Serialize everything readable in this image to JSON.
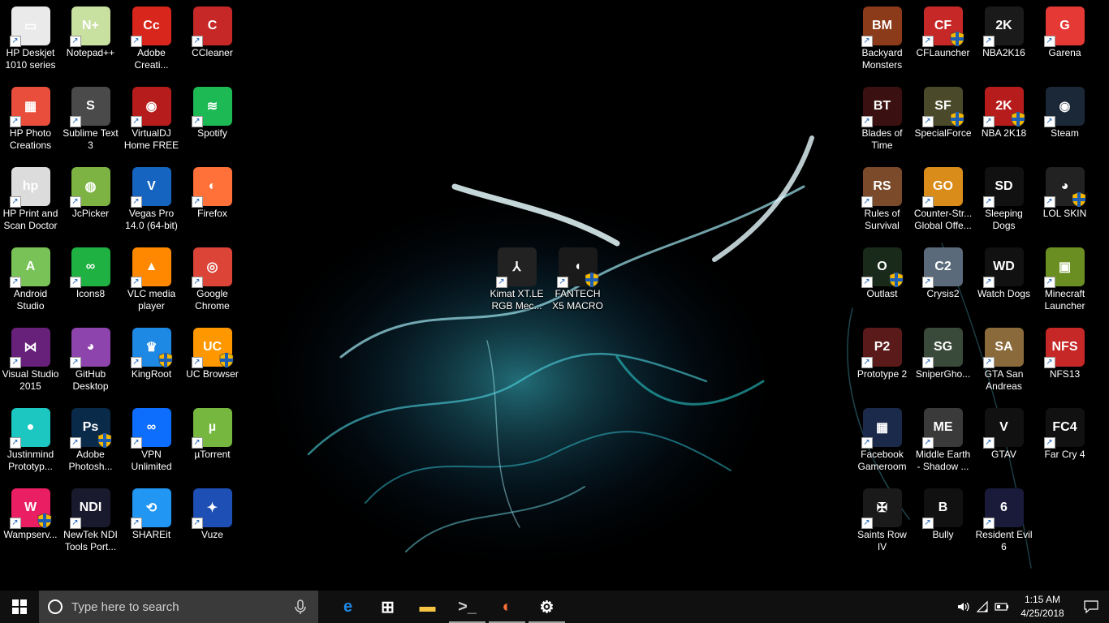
{
  "desktop": {
    "left_icons": [
      {
        "label": "HP Deskjet 1010 series",
        "icon": "printer-icon",
        "color": "#eaeaea",
        "glyph": "▭",
        "shield": false
      },
      {
        "label": "Notepad++",
        "icon": "notepad-plus-plus-icon",
        "color": "#c8e0a0",
        "glyph": "N+",
        "shield": false
      },
      {
        "label": "Adobe Creati...",
        "icon": "adobe-creative-cloud-icon",
        "color": "#d9261c",
        "glyph": "Cc",
        "shield": false
      },
      {
        "label": "CCleaner",
        "icon": "ccleaner-icon",
        "color": "#c62828",
        "glyph": "C",
        "shield": false
      },
      {
        "label": "HP Photo Creations",
        "icon": "hp-photo-creations-icon",
        "color": "#e94e3c",
        "glyph": "▦",
        "shield": false
      },
      {
        "label": "Sublime Text 3",
        "icon": "sublime-text-icon",
        "color": "#4a4a4a",
        "glyph": "S",
        "shield": false
      },
      {
        "label": "VirtualDJ Home FREE",
        "icon": "virtualdj-icon",
        "color": "#b71c1c",
        "glyph": "◉",
        "shield": false
      },
      {
        "label": "Spotify",
        "icon": "spotify-icon",
        "color": "#1db954",
        "glyph": "≋",
        "shield": false
      },
      {
        "label": "HP Print and Scan Doctor",
        "icon": "hp-print-scan-doctor-icon",
        "color": "#dcdcdc",
        "glyph": "hp",
        "shield": false
      },
      {
        "label": "JcPicker",
        "icon": "jcpicker-icon",
        "color": "#7cb342",
        "glyph": "◍",
        "shield": false
      },
      {
        "label": "Vegas Pro 14.0 (64-bit)",
        "icon": "vegas-pro-icon",
        "color": "#1565c0",
        "glyph": "V",
        "shield": false
      },
      {
        "label": "Firefox",
        "icon": "firefox-icon",
        "color": "#ff7139",
        "glyph": "◐",
        "shield": false
      },
      {
        "label": "Android Studio",
        "icon": "android-studio-icon",
        "color": "#78c257",
        "glyph": "A",
        "shield": false
      },
      {
        "label": "Icons8",
        "icon": "icons8-icon",
        "color": "#1fb141",
        "glyph": "∞",
        "shield": false
      },
      {
        "label": "VLC media player",
        "icon": "vlc-icon",
        "color": "#ff8800",
        "glyph": "▲",
        "shield": false
      },
      {
        "label": "Google Chrome",
        "icon": "chrome-icon",
        "color": "#db4437",
        "glyph": "◎",
        "shield": false
      },
      {
        "label": "Visual Studio 2015",
        "icon": "visual-studio-icon",
        "color": "#68217a",
        "glyph": "⋈",
        "shield": false
      },
      {
        "label": "GitHub Desktop",
        "icon": "github-desktop-icon",
        "color": "#8e44ad",
        "glyph": "◕",
        "shield": false
      },
      {
        "label": "KingRoot",
        "icon": "kingroot-icon",
        "color": "#1e88e5",
        "glyph": "♛",
        "shield": true
      },
      {
        "label": "UC Browser",
        "icon": "uc-browser-icon",
        "color": "#ff9800",
        "glyph": "UC",
        "shield": true
      },
      {
        "label": "Justinmind Prototyp...",
        "icon": "justinmind-icon",
        "color": "#1cc7c1",
        "glyph": "●",
        "shield": false
      },
      {
        "label": "Adobe Photosh...",
        "icon": "photoshop-icon",
        "color": "#0a2a4a",
        "glyph": "Ps",
        "shield": true
      },
      {
        "label": "VPN Unlimited",
        "icon": "vpn-unlimited-icon",
        "color": "#0d6efd",
        "glyph": "∞",
        "shield": false
      },
      {
        "label": "µTorrent",
        "icon": "utorrent-icon",
        "color": "#76b83f",
        "glyph": "µ",
        "shield": false
      },
      {
        "label": "Wampserv...",
        "icon": "wampserver-icon",
        "color": "#e91e63",
        "glyph": "W",
        "shield": true
      },
      {
        "label": "NewTek NDI Tools Port...",
        "icon": "newtek-ndi-icon",
        "color": "#1a1a2e",
        "glyph": "NDI",
        "shield": false
      },
      {
        "label": "SHAREit",
        "icon": "shareit-icon",
        "color": "#2196f3",
        "glyph": "⟲",
        "shield": false
      },
      {
        "label": "Vuze",
        "icon": "vuze-icon",
        "color": "#1e4fb4",
        "glyph": "✦",
        "shield": false
      }
    ],
    "right_icons": [
      {
        "label": "Backyard Monsters",
        "icon": "backyard-monsters-icon",
        "color": "#8b3a1a",
        "glyph": "BM",
        "shield": false
      },
      {
        "label": "CFLauncher",
        "icon": "cflauncher-icon",
        "color": "#c62828",
        "glyph": "CF",
        "shield": true
      },
      {
        "label": "NBA2K16",
        "icon": "nba2k16-icon",
        "color": "#1a1a1a",
        "glyph": "2K",
        "shield": false
      },
      {
        "label": "Garena",
        "icon": "garena-icon",
        "color": "#e53935",
        "glyph": "G",
        "shield": false
      },
      {
        "label": "Blades of Time",
        "icon": "blades-of-time-icon",
        "color": "#3b1010",
        "glyph": "BT",
        "shield": false
      },
      {
        "label": "SpecialForce",
        "icon": "specialforce-icon",
        "color": "#4a4a2a",
        "glyph": "SF",
        "shield": true
      },
      {
        "label": "NBA 2K18",
        "icon": "nba2k18-icon",
        "color": "#b71c1c",
        "glyph": "2K",
        "shield": true
      },
      {
        "label": "Steam",
        "icon": "steam-icon",
        "color": "#1b2838",
        "glyph": "◉",
        "shield": false
      },
      {
        "label": "Rules of Survival",
        "icon": "rules-of-survival-icon",
        "color": "#7a4a2a",
        "glyph": "RS",
        "shield": false
      },
      {
        "label": "Counter-Str... Global Offe...",
        "icon": "csgo-icon",
        "color": "#d98c1a",
        "glyph": "GO",
        "shield": false
      },
      {
        "label": "Sleeping Dogs",
        "icon": "sleeping-dogs-icon",
        "color": "#111111",
        "glyph": "SD",
        "shield": false
      },
      {
        "label": "LOL SKIN",
        "icon": "lol-skin-icon",
        "color": "#222222",
        "glyph": "◕",
        "shield": true
      },
      {
        "label": "Outlast",
        "icon": "outlast-icon",
        "color": "#1a2a1a",
        "glyph": "O",
        "shield": true
      },
      {
        "label": "Crysis2",
        "icon": "crysis2-icon",
        "color": "#5a6a7a",
        "glyph": "C2",
        "shield": false
      },
      {
        "label": "Watch Dogs",
        "icon": "watch-dogs-icon",
        "color": "#111111",
        "glyph": "WD",
        "shield": false
      },
      {
        "label": "Minecraft Launcher",
        "icon": "minecraft-icon",
        "color": "#6b8e23",
        "glyph": "▣",
        "shield": false
      },
      {
        "label": "Prototype 2",
        "icon": "prototype2-icon",
        "color": "#5a1a1a",
        "glyph": "P2",
        "shield": false
      },
      {
        "label": "SniperGho...",
        "icon": "sniper-ghost-icon",
        "color": "#3a4a3a",
        "glyph": "SG",
        "shield": false
      },
      {
        "label": "GTA San Andreas",
        "icon": "gta-sa-icon",
        "color": "#8a6a3a",
        "glyph": "SA",
        "shield": false
      },
      {
        "label": "NFS13",
        "icon": "nfs13-icon",
        "color": "#c62828",
        "glyph": "NFS",
        "shield": false
      },
      {
        "label": "Facebook Gameroom",
        "icon": "facebook-gameroom-icon",
        "color": "#1b2a4a",
        "glyph": "▦",
        "shield": false
      },
      {
        "label": "Middle Earth - Shadow ...",
        "icon": "middle-earth-icon",
        "color": "#3a3a3a",
        "glyph": "ME",
        "shield": false
      },
      {
        "label": "GTAV",
        "icon": "gtav-icon",
        "color": "#111111",
        "glyph": "V",
        "shield": false
      },
      {
        "label": "Far Cry 4",
        "icon": "far-cry-4-icon",
        "color": "#111111",
        "glyph": "FC4",
        "shield": false
      },
      {
        "label": "Saints Row IV",
        "icon": "saints-row-icon",
        "color": "#1a1a1a",
        "glyph": "✠",
        "shield": false
      },
      {
        "label": "Bully",
        "icon": "bully-icon",
        "color": "#111111",
        "glyph": "B",
        "shield": false
      },
      {
        "label": "Resident Evil 6",
        "icon": "resident-evil-6-icon",
        "color": "#1a1a3a",
        "glyph": "6",
        "shield": false
      }
    ],
    "center_icons": [
      {
        "label": "Kimat XT.LE RGB Mec...",
        "icon": "kimat-keyboard-icon",
        "color": "#222222",
        "glyph": "⅄",
        "shield": false
      },
      {
        "label": "FANTECH X5 MACRO G...",
        "icon": "fantech-mouse-icon",
        "color": "#1a1a1a",
        "glyph": "◖",
        "shield": true
      }
    ]
  },
  "taskbar": {
    "search_placeholder": "Type here to search",
    "pinned": [
      {
        "name": "internet-explorer-icon",
        "color": "#1e88e5",
        "glyph": "e"
      },
      {
        "name": "store-icon",
        "color": "#ffffff",
        "glyph": "⊞"
      },
      {
        "name": "file-explorer-icon",
        "color": "#f4c542",
        "glyph": "▬"
      },
      {
        "name": "command-prompt-icon",
        "color": "#cccccc",
        "glyph": ">_"
      },
      {
        "name": "firefox-icon",
        "color": "#ff7139",
        "glyph": "◐"
      },
      {
        "name": "settings-icon",
        "color": "#ffffff",
        "glyph": "⚙"
      }
    ],
    "time": "1:15 AM",
    "date": "4/25/2018"
  }
}
